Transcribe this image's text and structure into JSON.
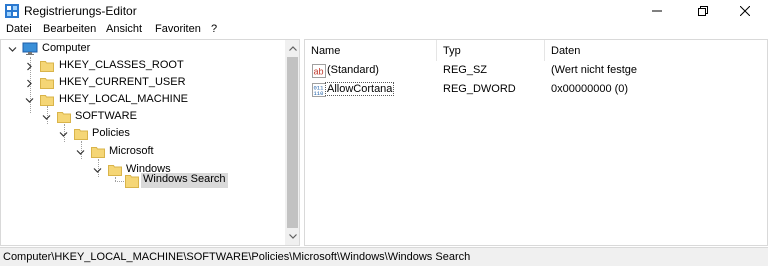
{
  "window": {
    "title": "Registrierungs-Editor"
  },
  "menu": {
    "items": [
      {
        "label": "Datei"
      },
      {
        "label": "Bearbeiten"
      },
      {
        "label": "Ansicht"
      },
      {
        "label": "Favoriten"
      },
      {
        "label": "?"
      }
    ]
  },
  "tree": {
    "items": [
      {
        "label": "Computer",
        "icon": "computer-icon",
        "expanded": true
      },
      {
        "label": "HKEY_CLASSES_ROOT",
        "icon": "folder-icon",
        "expanded": false
      },
      {
        "label": "HKEY_CURRENT_USER",
        "icon": "folder-icon",
        "expanded": false
      },
      {
        "label": "HKEY_LOCAL_MACHINE",
        "icon": "folder-icon",
        "expanded": true
      },
      {
        "label": "SOFTWARE",
        "icon": "folder-icon",
        "expanded": true
      },
      {
        "label": "Policies",
        "icon": "folder-icon",
        "expanded": true
      },
      {
        "label": "Microsoft",
        "icon": "folder-icon",
        "expanded": true
      },
      {
        "label": "Windows",
        "icon": "folder-icon",
        "expanded": true
      },
      {
        "label": "Windows Search",
        "icon": "folder-open-icon",
        "selected": true
      }
    ]
  },
  "list": {
    "columns": [
      {
        "label": "Name"
      },
      {
        "label": "Typ"
      },
      {
        "label": "Daten"
      }
    ],
    "rows": [
      {
        "name": "(Standard)",
        "type": "REG_SZ",
        "data": "(Wert nicht festge",
        "icon": "string-value-icon"
      },
      {
        "name": "AllowCortana",
        "type": "REG_DWORD",
        "data": "0x00000000 (0)",
        "icon": "dword-value-icon",
        "selected": true
      }
    ]
  },
  "status": {
    "path": "Computer\\HKEY_LOCAL_MACHINE\\SOFTWARE\\Policies\\Microsoft\\Windows\\Windows Search"
  },
  "colors": {
    "folder": "#f5d676",
    "folder_edge": "#d9b44a",
    "selection": "#d9d9d9",
    "statusbar": "#f0f0f0"
  }
}
